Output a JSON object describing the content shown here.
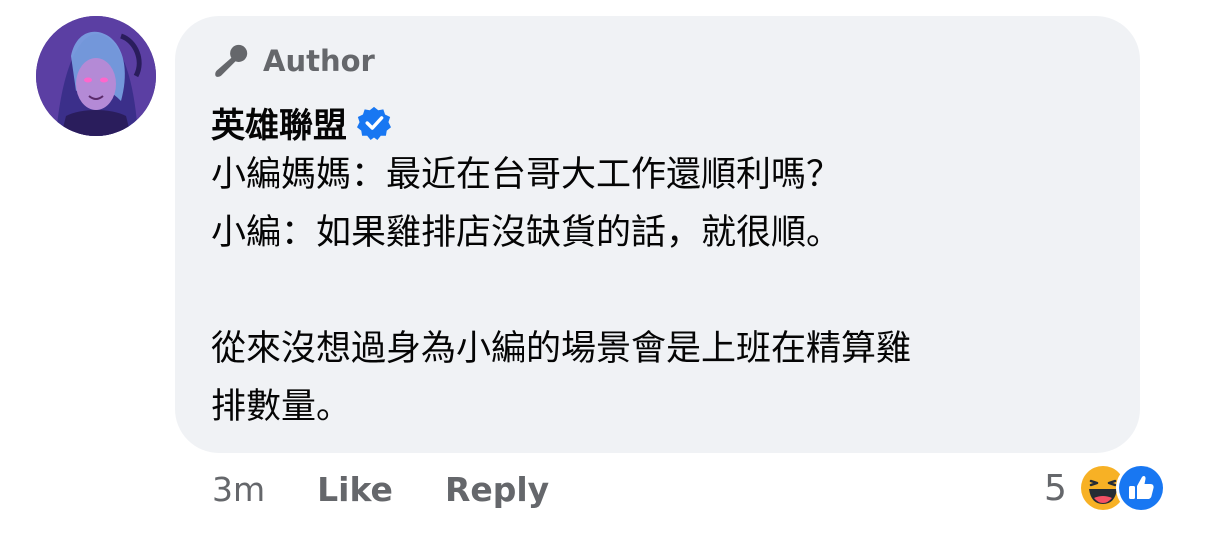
{
  "comment": {
    "author_badge": "Author",
    "author_name": "英雄聯盟",
    "body": "小編媽媽：最近在台哥大工作還順利嗎？\n小編：如果雞排店沒缺貨的話，就很順。\n\n從來沒想過身為小編的場景會是上班在精算雞\n排數量。",
    "timestamp": "3m",
    "like_label": "Like",
    "reply_label": "Reply",
    "reaction_count": "5"
  },
  "icons": {
    "badge": "microphone-icon",
    "verified": "verified-badge-icon",
    "reactions": [
      "haha-reaction-icon",
      "like-reaction-icon"
    ]
  },
  "colors": {
    "bubble": "#f0f2f5",
    "secondary_text": "#65676b",
    "verified_blue": "#1877f2",
    "haha_yellow": "#f7b125"
  }
}
